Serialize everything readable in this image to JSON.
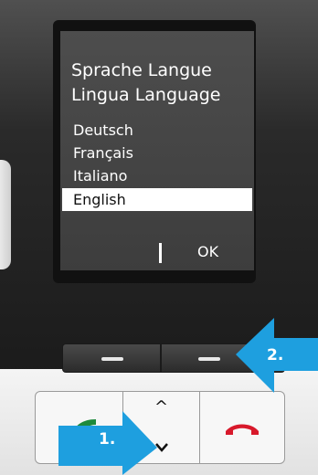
{
  "screen": {
    "title_line1": "Sprache Langue",
    "title_line2": "Lingua Language",
    "languages": [
      "Deutsch",
      "Français",
      "Italiano",
      "English"
    ],
    "selected": "English",
    "softkey_right": "OK"
  },
  "callouts": {
    "step1": "1.",
    "step2": "2."
  },
  "colors": {
    "callout_blue": "#1e9fdf",
    "call_green": "#1e8a3c",
    "end_red": "#d8192b"
  },
  "icons": {
    "call_key": "phone-handset-icon",
    "end_key": "end-call-icon",
    "nav_up": "caret-up-icon",
    "nav_down": "caret-down-icon"
  }
}
